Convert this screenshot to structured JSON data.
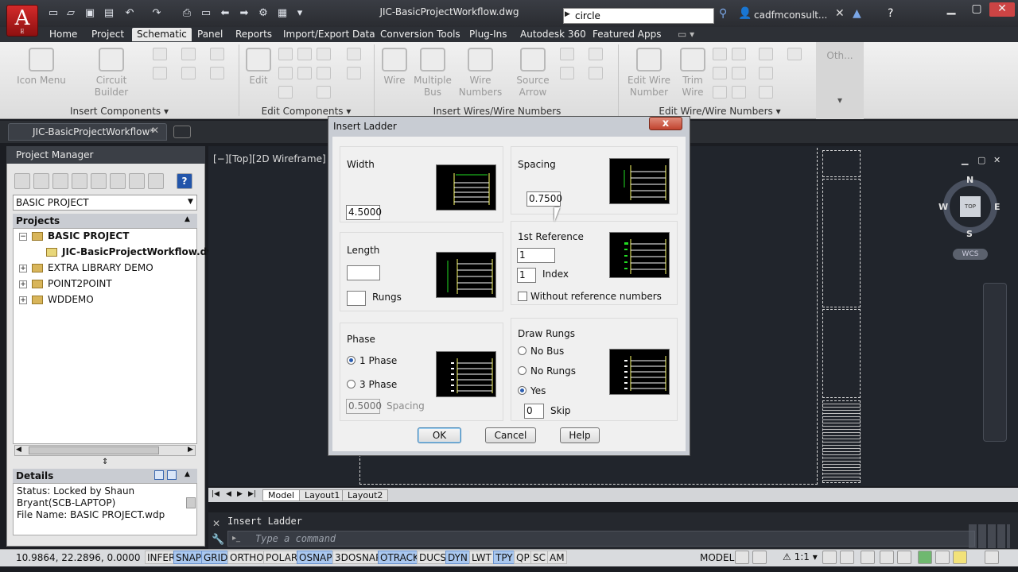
{
  "app": {
    "letter": "A",
    "edition": "E"
  },
  "window": {
    "title": "JIC-BasicProjectWorkflow.dwg"
  },
  "search": {
    "value": "circle"
  },
  "user": {
    "name": "cadfmconsult..."
  },
  "menu_tabs": [
    "Home",
    "Project",
    "Schematic",
    "Panel",
    "Reports",
    "Import/Export Data",
    "Conversion Tools",
    "Plug-Ins",
    "Autodesk 360",
    "Featured Apps"
  ],
  "active_menu_tab": "Schematic",
  "ribbon": {
    "buttons": {
      "icon_menu": "Icon Menu",
      "circuit_builder": "Circuit Builder",
      "edit": "Edit",
      "wire": "Wire",
      "multiple_bus": "Multiple Bus",
      "wire_numbers": "Wire Numbers",
      "source_arrow": "Source Arrow",
      "edit_wire_number": "Edit Wire Number",
      "trim_wire": "Trim Wire"
    },
    "panels": {
      "insert_components": "Insert Components",
      "edit_components": "Edit Components",
      "insert_wires": "Insert Wires/Wire Numbers",
      "edit_wires": "Edit Wire/Wire Numbers"
    },
    "other": "Oth..."
  },
  "file_tab": {
    "label": "JIC-BasicProjectWorkflow*"
  },
  "project_manager": {
    "title": "Project Manager",
    "selected_project": "BASIC PROJECT",
    "projects_header": "Projects",
    "tree": [
      {
        "label": "BASIC PROJECT",
        "expander": "−"
      },
      {
        "label": "JIC-BasicProjectWorkflow.dwg"
      },
      {
        "label": "EXTRA LIBRARY DEMO",
        "expander": "+"
      },
      {
        "label": "POINT2POINT",
        "expander": "+"
      },
      {
        "label": "WDDEMO",
        "expander": "+"
      }
    ],
    "details_header": "Details",
    "details": {
      "status": "Status: Locked by Shaun Bryant(SCB-LAPTOP)",
      "file": "File Name: BASIC PROJECT.wdp"
    },
    "help_glyph": "?"
  },
  "viewport": {
    "label": "[−][Top][2D Wireframe]",
    "viewcube": {
      "top": "TOP",
      "n": "N",
      "s": "S",
      "e": "E",
      "w": "W",
      "wcs": "WCS"
    }
  },
  "layout_tabs": [
    "Model",
    "Layout1",
    "Layout2"
  ],
  "command": {
    "history": "Insert Ladder",
    "placeholder": "Type a command"
  },
  "status_bar": {
    "coords": "10.9864, 22.2896, 0.0000",
    "toggles": [
      {
        "label": "INFER",
        "on": false
      },
      {
        "label": "SNAP",
        "on": true
      },
      {
        "label": "GRID",
        "on": true
      },
      {
        "label": "ORTHO",
        "on": false
      },
      {
        "label": "POLAR",
        "on": false
      },
      {
        "label": "OSNAP",
        "on": true
      },
      {
        "label": "3DOSNAP",
        "on": false
      },
      {
        "label": "OTRACK",
        "on": true
      },
      {
        "label": "DUCS",
        "on": false
      },
      {
        "label": "DYN",
        "on": true
      },
      {
        "label": "LWT",
        "on": false
      },
      {
        "label": "TPY",
        "on": true
      },
      {
        "label": "QP",
        "on": false
      },
      {
        "label": "SC",
        "on": false
      },
      {
        "label": "AM",
        "on": false
      }
    ],
    "space": "MODEL",
    "scale": "1:1"
  },
  "dialog": {
    "title": "Insert Ladder",
    "close": "x",
    "width": {
      "label": "Width",
      "value": "4.5000"
    },
    "spacing": {
      "label": "Spacing",
      "value": "0.7500"
    },
    "length": {
      "label": "Length",
      "value": "",
      "rungs_label": "Rungs",
      "rungs_value": ""
    },
    "reference": {
      "label": "1st Reference",
      "value": "1",
      "index_label": "Index",
      "index_value": "1",
      "without_label": "Without reference numbers"
    },
    "phase": {
      "label": "Phase",
      "one": "1 Phase",
      "three": "3 Phase",
      "spacing_value": "0.5000",
      "spacing_label": "Spacing",
      "selected": "1 Phase"
    },
    "draw_rungs": {
      "label": "Draw Rungs",
      "no_bus": "No Bus",
      "no_rungs": "No Rungs",
      "yes": "Yes",
      "skip_value": "0",
      "skip_label": "Skip",
      "selected": "Yes"
    },
    "buttons": {
      "ok": "OK",
      "cancel": "Cancel",
      "help": "Help"
    }
  }
}
